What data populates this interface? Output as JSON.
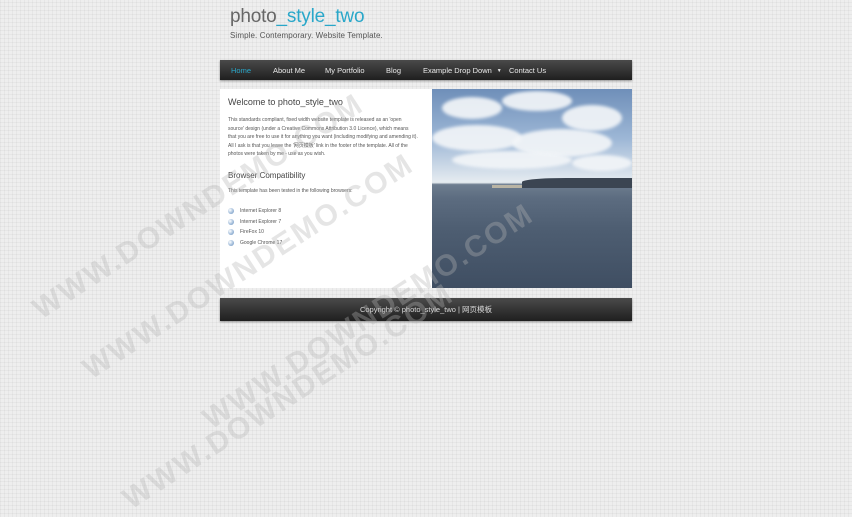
{
  "site": {
    "logo_prefix": "photo",
    "logo_accent": "_style_two",
    "slogan": "Simple. Contemporary. Website Template.",
    "accent_color": "#29a7c9"
  },
  "nav": {
    "items": [
      {
        "label": "Home",
        "active": true
      },
      {
        "label": "About Me"
      },
      {
        "label": "My Portfolio"
      },
      {
        "label": "Blog"
      },
      {
        "label": "Example Drop Down",
        "has_dropdown": true
      },
      {
        "label": "Contact Us"
      }
    ]
  },
  "main": {
    "title": "Welcome to photo_style_two",
    "intro": "This standards compliant, fixed width website template is released as an 'open source' design (under a Creative Commons Attribution 3.0 Licence), which means that you are free to use it for anything you want (including modifying and amending it). All I ask is that you leave the '网页模板' link in the footer of the template. All of the photos were taken by me - use as you wish.",
    "subtitle": "Browser Compatibility",
    "browser_intro": "This template has been tested in the following browsers:",
    "browsers": [
      "Internet Explorer 8",
      "Internet Explorer 7",
      "FireFox 10",
      "Google Chrome 17"
    ]
  },
  "footer": {
    "text": "Copyright © photo_style_two | 网页模板"
  },
  "watermark": {
    "text": "WWW.DOWNDEMO.COM"
  }
}
